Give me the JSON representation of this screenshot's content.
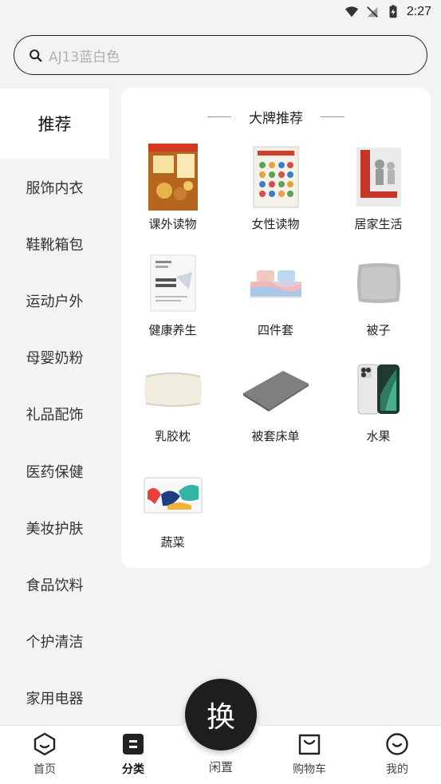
{
  "status_bar": {
    "time": "2:27"
  },
  "search": {
    "placeholder": "AJ13蓝白色"
  },
  "sidebar": {
    "items": [
      {
        "label": "推荐",
        "active": true
      },
      {
        "label": "服饰内衣"
      },
      {
        "label": "鞋靴箱包"
      },
      {
        "label": "运动户外"
      },
      {
        "label": "母婴奶粉"
      },
      {
        "label": "礼品配饰"
      },
      {
        "label": "医药保健"
      },
      {
        "label": "美妆护肤"
      },
      {
        "label": "食品饮料"
      },
      {
        "label": "个护清洁"
      },
      {
        "label": "家用电器"
      }
    ]
  },
  "panel": {
    "title": "大牌推荐",
    "products": [
      {
        "label": "课外读物",
        "icon": "baking-book-image"
      },
      {
        "label": "女性读物",
        "icon": "health-book-image"
      },
      {
        "label": "居家生活",
        "icon": "novel-book-image"
      },
      {
        "label": "健康养生",
        "icon": "economics-book-image"
      },
      {
        "label": "四件套",
        "icon": "bedding-set-image"
      },
      {
        "label": "被子",
        "icon": "pillow-image"
      },
      {
        "label": "乳胶枕",
        "icon": "latex-pillow-image"
      },
      {
        "label": "被套床单",
        "icon": "carpet-image"
      },
      {
        "label": "水果",
        "icon": "phone-image"
      },
      {
        "label": "蔬菜",
        "icon": "tablet-image"
      }
    ]
  },
  "bottom_nav": {
    "items": [
      {
        "label": "首页"
      },
      {
        "label": "分类",
        "active": true
      },
      {
        "label": "闲置"
      },
      {
        "label": "购物车"
      },
      {
        "label": "我的"
      }
    ],
    "center_button": "换"
  }
}
